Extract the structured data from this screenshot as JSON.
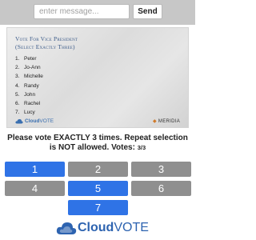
{
  "message_bar": {
    "placeholder": "enter message...",
    "send_label": "Send"
  },
  "ballot": {
    "title_line1": "Vote For Vice President",
    "title_line2": "(Select Exactly Three)",
    "candidates": [
      {
        "num": "1.",
        "name": "Peter"
      },
      {
        "num": "2.",
        "name": "Jo-Ann"
      },
      {
        "num": "3.",
        "name": "Michelle"
      },
      {
        "num": "4.",
        "name": "Randy"
      },
      {
        "num": "5.",
        "name": "John"
      },
      {
        "num": "6.",
        "name": "Rachel"
      },
      {
        "num": "7.",
        "name": "Lucy"
      }
    ],
    "brand_cloud": "Cloud",
    "brand_vote": "VOTE",
    "partner": "MERIDIA"
  },
  "instructions": {
    "text": "Please vote EXACTLY 3 times. Repeat selection is NOT allowed. Votes:",
    "votes_count": "3/3"
  },
  "vote_buttons": [
    {
      "label": "1",
      "selected": true
    },
    {
      "label": "2",
      "selected": false
    },
    {
      "label": "3",
      "selected": false
    },
    {
      "label": "4",
      "selected": false
    },
    {
      "label": "5",
      "selected": true
    },
    {
      "label": "6",
      "selected": false
    },
    {
      "label": "7",
      "selected": true
    }
  ],
  "footer": {
    "logo_cloud": "Cloud",
    "logo_vote": "VOTE"
  },
  "colors": {
    "selected": "#2f73e6",
    "unselected": "#8f8f8f",
    "brand": "#2d63b0"
  },
  "icons": {
    "ballot_logo": "cloud-icon",
    "partner_logo": "meridia-mark-icon",
    "footer_logo": "cloud-icon"
  }
}
